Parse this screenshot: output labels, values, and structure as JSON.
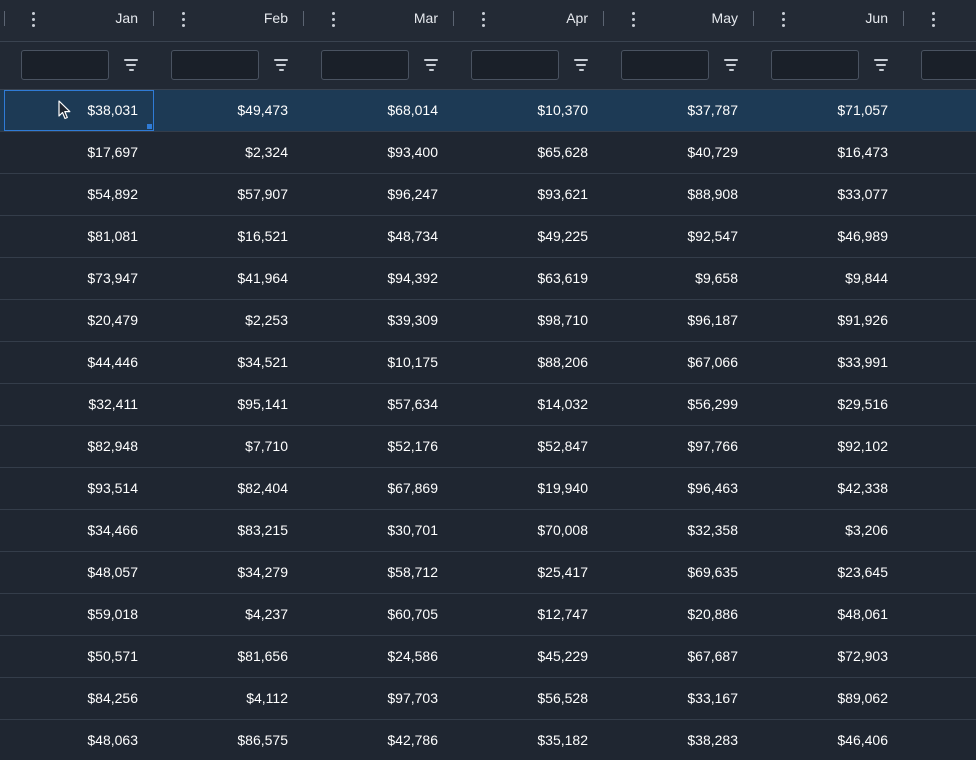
{
  "columns": [
    "Jan",
    "Feb",
    "Mar",
    "Apr",
    "May",
    "Jun",
    ""
  ],
  "filters": [
    {
      "value": "",
      "placeholder": ""
    },
    {
      "value": "",
      "placeholder": ""
    },
    {
      "value": "",
      "placeholder": ""
    },
    {
      "value": "",
      "placeholder": ""
    },
    {
      "value": "",
      "placeholder": ""
    },
    {
      "value": "",
      "placeholder": ""
    },
    {
      "value": "",
      "placeholder": ""
    }
  ],
  "icons": {
    "column_menu": "vertical-dots-icon",
    "filter": "filter-lines-icon",
    "cursor": "mouse-pointer-icon"
  },
  "colors": {
    "background": "#1f2631",
    "header": "#232a35",
    "selected_row": "#1d3a55",
    "focus_border": "#2f7bd6",
    "text": "#ffffff"
  },
  "selection": {
    "row": 1,
    "column": "Jan"
  },
  "rows": [
    [
      "$38,031",
      "$49,473",
      "$68,014",
      "$10,370",
      "$37,787",
      "$71,057"
    ],
    [
      "$17,697",
      "$2,324",
      "$93,400",
      "$65,628",
      "$40,729",
      "$16,473"
    ],
    [
      "$54,892",
      "$57,907",
      "$96,247",
      "$93,621",
      "$88,908",
      "$33,077"
    ],
    [
      "$81,081",
      "$16,521",
      "$48,734",
      "$49,225",
      "$92,547",
      "$46,989"
    ],
    [
      "$73,947",
      "$41,964",
      "$94,392",
      "$63,619",
      "$9,658",
      "$9,844"
    ],
    [
      "$20,479",
      "$2,253",
      "$39,309",
      "$98,710",
      "$96,187",
      "$91,926"
    ],
    [
      "$44,446",
      "$34,521",
      "$10,175",
      "$88,206",
      "$67,066",
      "$33,991"
    ],
    [
      "$32,411",
      "$95,141",
      "$57,634",
      "$14,032",
      "$56,299",
      "$29,516"
    ],
    [
      "$82,948",
      "$7,710",
      "$52,176",
      "$52,847",
      "$97,766",
      "$92,102"
    ],
    [
      "$93,514",
      "$82,404",
      "$67,869",
      "$19,940",
      "$96,463",
      "$42,338"
    ],
    [
      "$34,466",
      "$83,215",
      "$30,701",
      "$70,008",
      "$32,358",
      "$3,206"
    ],
    [
      "$48,057",
      "$34,279",
      "$58,712",
      "$25,417",
      "$69,635",
      "$23,645"
    ],
    [
      "$59,018",
      "$4,237",
      "$60,705",
      "$12,747",
      "$20,886",
      "$48,061"
    ],
    [
      "$50,571",
      "$81,656",
      "$24,586",
      "$45,229",
      "$67,687",
      "$72,903"
    ],
    [
      "$84,256",
      "$4,112",
      "$97,703",
      "$56,528",
      "$33,167",
      "$89,062"
    ],
    [
      "$48,063",
      "$86,575",
      "$42,786",
      "$35,182",
      "$38,283",
      "$46,406"
    ]
  ]
}
